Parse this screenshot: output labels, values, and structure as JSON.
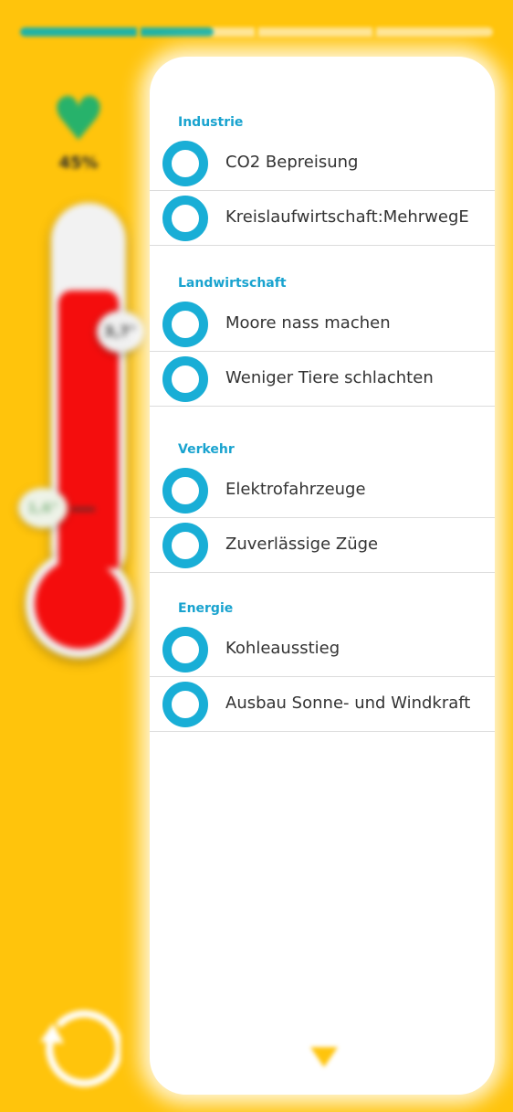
{
  "top_progress": {
    "steps": [
      "",
      "",
      "",
      ""
    ],
    "progress": 0.41
  },
  "sidebar": {
    "heart_icon": "heart-icon",
    "score": "45%",
    "thermometer": {
      "top_badge": "3,7°",
      "left_badge": "1,6°",
      "fill_level": 0.8
    },
    "reset_icon": "restart-icon"
  },
  "categories": [
    {
      "label": "Industrie",
      "options": [
        {
          "label": "CO2 Bepreisung"
        },
        {
          "label": "Kreislaufwirtschaft:MehrwegE"
        }
      ]
    },
    {
      "label": "Landwirtschaft",
      "options": [
        {
          "label": "Moore nass machen"
        },
        {
          "label": "Weniger Tiere schlachten"
        }
      ]
    },
    {
      "label": "Verkehr",
      "options": [
        {
          "label": "Elektrofahrzeuge"
        },
        {
          "label": "Zuverlässige Züge"
        }
      ]
    },
    {
      "label": "Energie",
      "options": [
        {
          "label": "Kohleausstieg"
        },
        {
          "label": "Ausbau Sonne- und Windkraft"
        }
      ]
    }
  ],
  "colors": {
    "background": "#FFC40C",
    "accent": "#19aed6",
    "heart": "#27b26b",
    "thermometer": "#f40d0d"
  },
  "footer": {
    "down_icon": "chevron-down-icon"
  }
}
